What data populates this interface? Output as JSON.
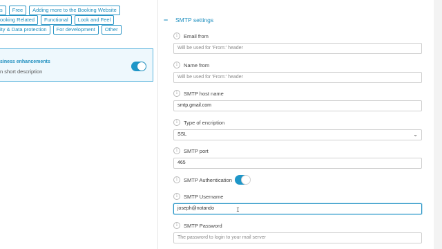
{
  "tags": {
    "row1": [
      "Free",
      "Adding more to the Booking Website"
    ],
    "row1_partial": "s",
    "row2": [
      "ooking Related",
      "Functional",
      "Look and Feel"
    ],
    "row3": [
      "ity & Data protection",
      "For development",
      "Other"
    ]
  },
  "card": {
    "title": "siness enhancements",
    "description": "n short description",
    "toggle_on": true
  },
  "smtp": {
    "section_title": "SMTP settings",
    "fields": {
      "email_from": {
        "label": "Email from",
        "value": "",
        "placeholder": "Will be used for 'From:' header"
      },
      "name_from": {
        "label": "Name from",
        "value": "",
        "placeholder": "Will be used for 'From:' header"
      },
      "host": {
        "label": "SMTP host name",
        "value": "smtp.gmail.com"
      },
      "encryption": {
        "label": "Type of encription",
        "value": "SSL"
      },
      "port": {
        "label": "SMTP port",
        "value": "465"
      },
      "auth": {
        "label": "SMTP Authentication",
        "enabled": true
      },
      "username": {
        "label": "SMTP Username",
        "value": "joseph@notando"
      },
      "password": {
        "label": "SMTP Password",
        "value": "",
        "placeholder": "The password to login to your mail server"
      }
    }
  },
  "colors": {
    "accent": "#1f8fbf",
    "toggle": "#1e96c8",
    "card_bg": "#eef8fd"
  }
}
